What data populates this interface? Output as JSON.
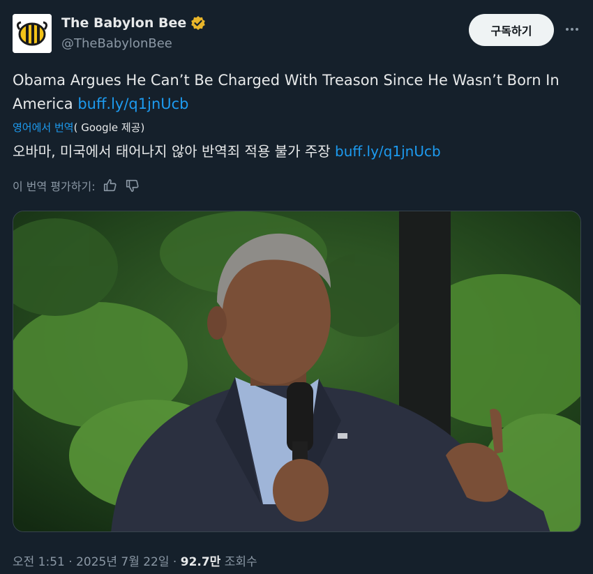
{
  "account": {
    "display_name": "The Babylon Bee",
    "handle": "@TheBabylonBee",
    "verified_color": "#e8b52a"
  },
  "header": {
    "subscribe_label": "구독하기",
    "more_icon": "more-horizontal-icon"
  },
  "tweet": {
    "text": "Obama Argues He Can’t Be Charged With Treason Since He Wasn’t Born In America ",
    "link": "buff.ly/q1jnUcb"
  },
  "translation": {
    "label": "영어에서 번역",
    "provider": "( Google 제공)",
    "text": "오바마, 미국에서 태어나지 않아 반역죄 적용 불가 주장 ",
    "link": "buff.ly/q1jnUcb",
    "rate_label": "이 번역 평가하기:"
  },
  "meta": {
    "time": "오전 1:51 · 2025년 7월 22일 · ",
    "views_count": "92.7만",
    "views_label": " 조회수"
  },
  "colors": {
    "background": "#15202b",
    "link": "#1d9bf0",
    "muted": "#8b98a5"
  }
}
